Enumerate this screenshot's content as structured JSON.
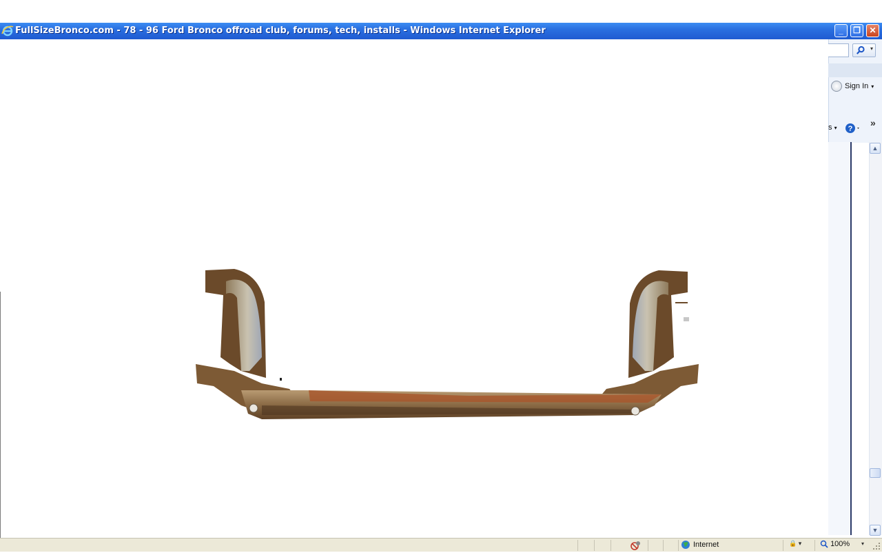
{
  "window": {
    "title": "FullSizeBronco.com - 78 - 96 Ford Bronco offroad club, forums, tech, installs - Windows Internet Explorer",
    "controls": {
      "minimize": "_",
      "maximize": "❐",
      "close": "✕"
    }
  },
  "toolbar": {
    "sign_in_label": "Sign In",
    "tools_tail": "s",
    "more_chevron": "»"
  },
  "status_bar": {
    "zone_label": "Internet",
    "zoom_label": "100%"
  },
  "colors": {
    "title_bar": "#2a6fe0",
    "status_bar": "#ece9d8",
    "rust": "#8a5a2b"
  },
  "icons": [
    "ie-logo-icon",
    "minimize-icon",
    "maximize-icon",
    "close-icon",
    "search-icon",
    "chevron-down-icon",
    "user-circle-icon",
    "help-icon",
    "globe-icon",
    "privacy-icon",
    "zoom-icon",
    "resize-grip-icon",
    "scroll-up-icon",
    "scroll-down-icon"
  ]
}
